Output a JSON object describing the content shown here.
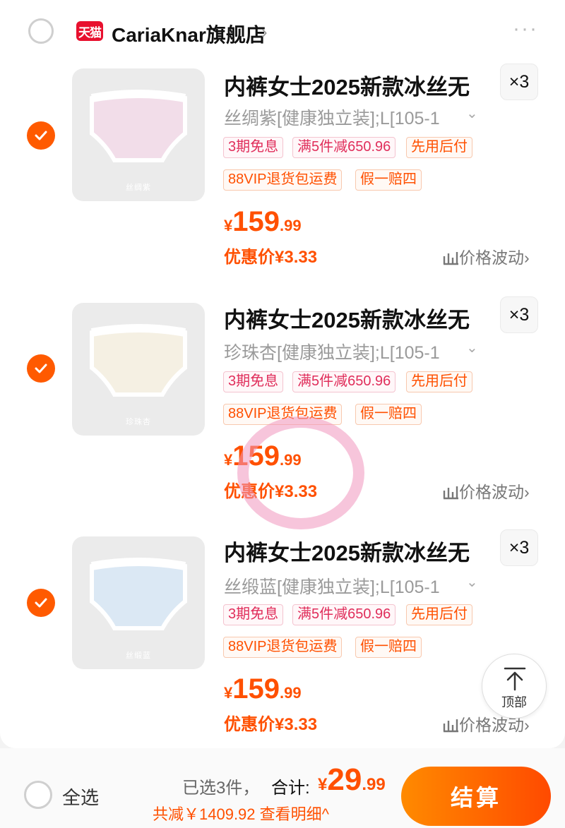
{
  "store": {
    "badge": "天猫",
    "name": "CariaKnar旗舰店",
    "more_label": "···"
  },
  "items": [
    {
      "thumb_label": "丝绸紫",
      "thumb_color": "#f2dde9",
      "title": "内裤女士2025新款冰丝无",
      "quantity": "×3",
      "sku": "丝绸紫[健康独立装];L[105-1",
      "tags": [
        "3期免息",
        "满5件减650.96",
        "先用后付",
        "88VIP退货包运费",
        "假一赔四"
      ],
      "price_symbol": "¥",
      "price_int": "159",
      "price_dec": ".99",
      "promo_price": "优惠价¥3.33",
      "price_trend": "价格波动"
    },
    {
      "thumb_label": "珍珠杏",
      "thumb_color": "#f5f0e3",
      "title": "内裤女士2025新款冰丝无",
      "quantity": "×3",
      "sku": "珍珠杏[健康独立装];L[105-1",
      "tags": [
        "3期免息",
        "满5件减650.96",
        "先用后付",
        "88VIP退货包运费",
        "假一赔四"
      ],
      "price_symbol": "¥",
      "price_int": "159",
      "price_dec": ".99",
      "promo_price": "优惠价¥3.33",
      "price_trend": "价格波动"
    },
    {
      "thumb_label": "丝缎蓝",
      "thumb_color": "#dbe8f4",
      "title": "内裤女士2025新款冰丝无",
      "quantity": "×3",
      "sku": "丝缎蓝[健康独立装];L[105-1",
      "tags": [
        "3期免息",
        "满5件减650.96",
        "先用后付",
        "88VIP退货包运费",
        "假一赔四"
      ],
      "price_symbol": "¥",
      "price_int": "159",
      "price_dec": ".99",
      "promo_price": "优惠价¥3.33",
      "price_trend": "价格波动"
    }
  ],
  "back_to_top": {
    "label": "顶部"
  },
  "footer": {
    "select_all": "全选",
    "selected_count": "已选3件，",
    "total_label": "合计:",
    "total_symbol": "¥",
    "total_int": "29",
    "total_dec": ".99",
    "discount": "共减￥1409.92 查看明细^",
    "checkout": "结算"
  },
  "colors": {
    "accent": "#ff5000",
    "tmall_red": "#e8102e"
  }
}
